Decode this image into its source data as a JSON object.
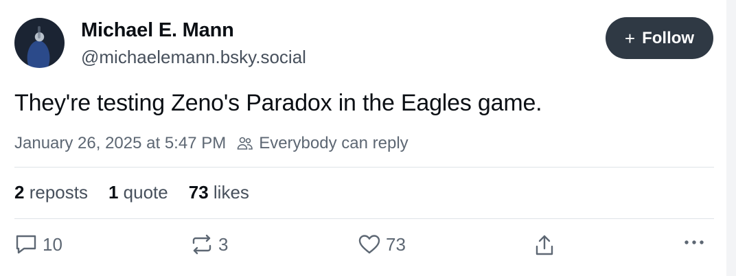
{
  "post": {
    "author_name": "Michael E. Mann",
    "author_handle": "@michaelemann.bsky.social",
    "follow_label": "Follow",
    "text": "They're testing Zeno's Paradox in the Eagles game.",
    "timestamp": "January 26, 2025 at 5:47 PM",
    "reply_setting": "Everybody can reply"
  },
  "stats": {
    "reposts_count": "2",
    "reposts_label": "reposts",
    "quotes_count": "1",
    "quotes_label": "quote",
    "likes_count": "73",
    "likes_label": "likes"
  },
  "actions": {
    "reply_count": "10",
    "repost_count": "3",
    "like_count": "73"
  },
  "icons": {
    "reply": "speech-bubble-icon",
    "repost": "repost-arrows-icon",
    "like": "heart-icon",
    "share": "share-icon",
    "more": "more-dots-icon",
    "people": "people-icon",
    "plus": "plus-icon"
  },
  "colors": {
    "follow_bg": "#2f3944",
    "text": "#0b0f14",
    "muted": "#5d6773",
    "divider": "#dfe3e8"
  }
}
